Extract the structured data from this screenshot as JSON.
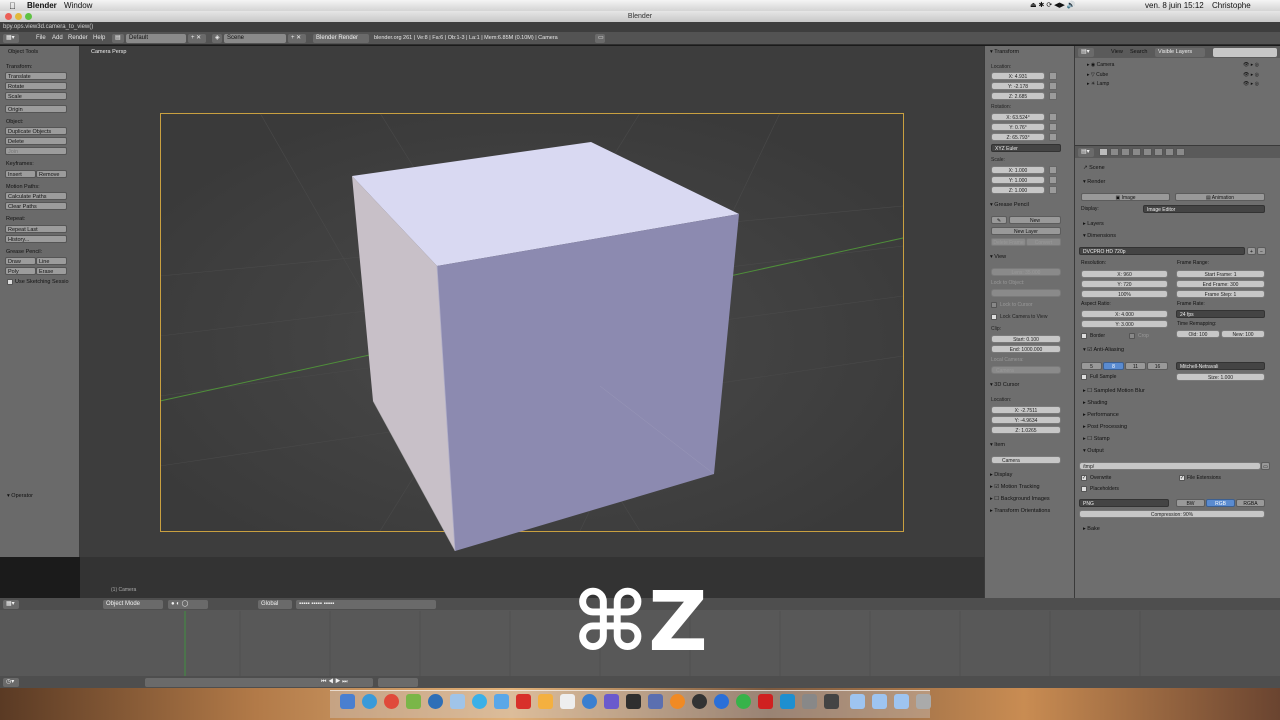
{
  "mac_menubar": {
    "app": "Blender",
    "menu": "Window",
    "datetime": "ven. 8 juin  15:12",
    "user": "Christophe"
  },
  "window": {
    "title": "Blender"
  },
  "info": {
    "python_report": "bpy.ops.view3d.camera_to_view()"
  },
  "header": {
    "menus": [
      "File",
      "Add",
      "Render",
      "Help"
    ],
    "screen_layout": "Default",
    "scene": "Scene",
    "render_engine": "Blender Render",
    "stats": "blender.org 261 | Ve:8 | Fa:6 | Ob:1-3 | La:1 | Mem:6.85M (0.10M) | Camera"
  },
  "toolshelf": {
    "title": "Object Tools",
    "transform_label": "Transform:",
    "translate": "Translate",
    "rotate": "Rotate",
    "scale": "Scale",
    "origin": "Origin",
    "object_label": "Object:",
    "duplicate": "Duplicate Objects",
    "delete": "Delete",
    "join": "Join",
    "keyframes_label": "Keyframes:",
    "insert": "Insert",
    "remove": "Remove",
    "motion_paths_label": "Motion Paths:",
    "calculate_paths": "Calculate Paths",
    "clear_paths": "Clear Paths",
    "repeat_label": "Repeat:",
    "repeat_last": "Repeat Last",
    "history": "History...",
    "grease_label": "Grease Pencil:",
    "draw": "Draw",
    "line": "Line",
    "poly": "Poly",
    "erase": "Erase",
    "use_sketching": "Use Sketching Sessio",
    "operator": "Operator"
  },
  "viewport": {
    "label": "Camera Persp",
    "object_label": "(1) Camera"
  },
  "npanel": {
    "transform": "Transform",
    "location_label": "Location:",
    "loc_x": "X: 4.931",
    "loc_y": "Y: -2.178",
    "loc_z": "Z: 2.685",
    "rotation_label": "Rotation:",
    "rot_x": "X: 63.524°",
    "rot_y": "Y: 0.76°",
    "rot_z": "Z: 65.793°",
    "rotation_mode": "XYZ Euler",
    "scale_label": "Scale:",
    "scale_x": "X: 1.000",
    "scale_y": "Y: 1.000",
    "scale_z": "Z: 1.000",
    "grease_pencil": "Grease Pencil",
    "gp_new": "New",
    "gp_new_layer": "New Layer",
    "gp_delete_frame": "Delete Frame",
    "gp_convert": "Convert",
    "view": "View",
    "lens": "Lens: 35.000",
    "lock_to_object": "Lock to Object:",
    "lock_to_cursor": "Lock to Cursor",
    "lock_camera_to_view": "Lock Camera to View",
    "clip_label": "Clip:",
    "clip_start": "Start: 0.100",
    "clip_end": "End: 1000.000",
    "local_camera": "Local Camera:",
    "local_camera_value": "Camera",
    "cursor_3d": "3D Cursor",
    "cursor_location": "Location:",
    "cur_x": "X: -2.7511",
    "cur_y": "Y: -4.9634",
    "cur_z": "Z: 1.0265",
    "item": "Item",
    "item_name": "Camera",
    "display": "Display",
    "motion_tracking": "Motion Tracking",
    "background_images": "Background Images",
    "transform_orientations": "Transform Orientations"
  },
  "outliner": {
    "view": "View",
    "search": "Search",
    "filter": "Visible Layers",
    "items": [
      "Camera",
      "Cube",
      "Lamp"
    ]
  },
  "properties": {
    "scene": "Scene",
    "render": "Render",
    "image": "Image",
    "animation": "Animation",
    "display_label": "Display:",
    "display_value": "Image Editor",
    "layers": "Layers",
    "dimensions": "Dimensions",
    "preset": "DVCPRO HD 720p",
    "resolution_label": "Resolution:",
    "res_x": "X: 960",
    "res_y": "Y: 720",
    "res_pct": "100%",
    "frame_range_label": "Frame Range:",
    "start_frame": "Start Frame: 1",
    "end_frame": "End Frame: 300",
    "frame_step": "Frame Step: 1",
    "aspect_label": "Aspect Ratio:",
    "aspect_x": "X: 4.000",
    "aspect_y": "Y: 3.000",
    "frame_rate_label": "Frame Rate:",
    "frame_rate": "24 fps",
    "time_remap_label": "Time Remapping:",
    "old": "Old: 100",
    "new": "New: 100",
    "border": "Border",
    "crop": "Crop",
    "anti_aliasing": "Anti-Aliasing",
    "aa_5": "5",
    "aa_8": "8",
    "aa_11": "11",
    "aa_16": "16",
    "filter": "Mitchell-Netravali",
    "full_sample": "Full Sample",
    "size": "Size: 1.000",
    "sampled_motion_blur": "Sampled Motion Blur",
    "shading": "Shading",
    "performance": "Performance",
    "post_processing": "Post Processing",
    "stamp": "Stamp",
    "output": "Output",
    "output_path": "/tmp/",
    "overwrite": "Overwrite",
    "file_extensions": "File Extensions",
    "placeholders": "Placeholders",
    "format": "PNG",
    "bw": "BW",
    "rgb": "RGB",
    "rgba": "RGBA",
    "compression": "Compression: 90%",
    "bake": "Bake"
  },
  "timeline": {
    "mode": "Object Mode",
    "shading": "Global"
  },
  "shortcut_overlay": "⌘Z"
}
